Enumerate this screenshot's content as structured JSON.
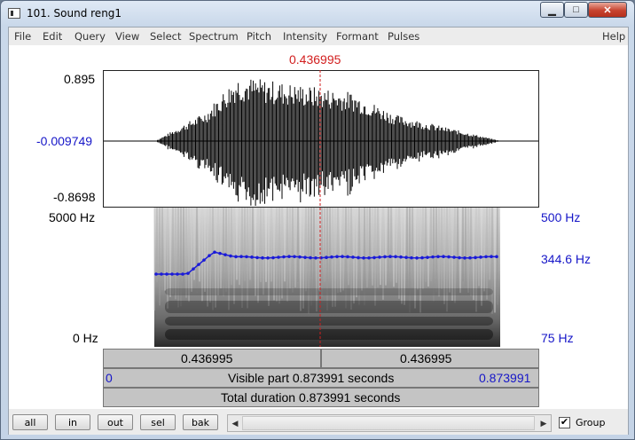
{
  "window": {
    "title": "101. Sound reng1"
  },
  "window_controls": {
    "minimize": "▁",
    "maximize": "□",
    "close": "✕"
  },
  "menu": [
    "File",
    "Edit",
    "Query",
    "View",
    "Select",
    "Spectrum",
    "Pitch",
    "Intensity",
    "Formant",
    "Pulses",
    "Help"
  ],
  "cursor": {
    "time": "0.436995"
  },
  "waveform": {
    "top_label": "0.895",
    "mid_label": "-0.009749",
    "bottom_label": "-0.8698"
  },
  "spectrogram": {
    "top_freq": "5000 Hz",
    "bottom_freq": "0 Hz"
  },
  "pitch": {
    "top": "500 Hz",
    "current": "344.6 Hz",
    "bottom": "75 Hz"
  },
  "bars": {
    "left_segment": "0.436995",
    "right_segment": "0.436995",
    "visible_start": "0",
    "visible_text": "Visible part 0.873991 seconds",
    "visible_end": "0.873991",
    "total_text": "Total duration 0.873991 seconds"
  },
  "buttons": {
    "all": "all",
    "in": "in",
    "out": "out",
    "sel": "sel",
    "bak": "bak"
  },
  "scrollbar": {
    "left_arrow": "◀",
    "right_arrow": "▶"
  },
  "group": {
    "checked": true,
    "label": "Group",
    "mark": "✔"
  },
  "colors": {
    "cursor": "#d21e1e",
    "axis_value": "#1616c8",
    "pitch_curve": "#1a1ad8"
  }
}
